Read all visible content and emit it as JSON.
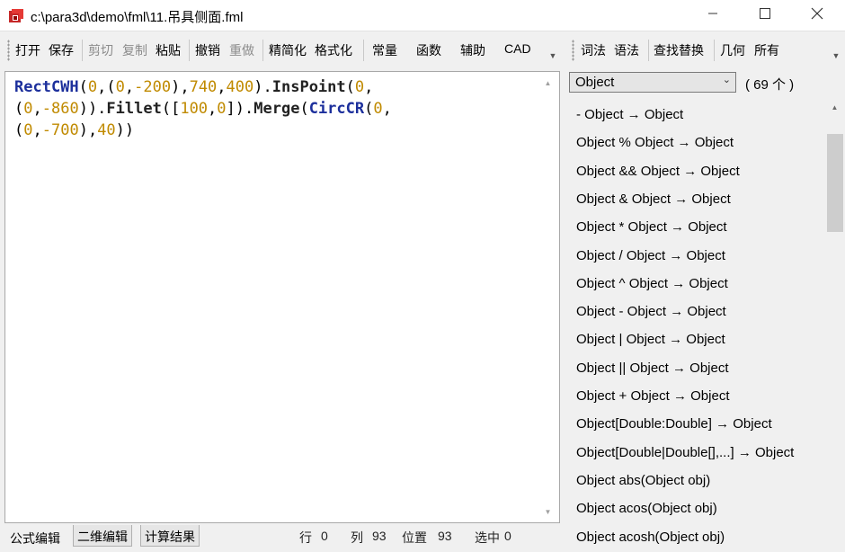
{
  "window": {
    "title": "c:\\para3d\\demo\\fml\\11.吊具侧面.fml",
    "min_glyph": "─",
    "max_glyph": "☐",
    "close_glyph": "✕"
  },
  "toolbar": {
    "open": "打开",
    "save": "保存",
    "cut": "剪切",
    "copy": "复制",
    "paste": "粘贴",
    "undo": "撤销",
    "redo": "重做",
    "simplify": "精简化",
    "format": "格式化",
    "constants": "常量",
    "functions": "函数",
    "helper": "辅助",
    "cad": "CAD"
  },
  "right_toolbar": {
    "lexer": "词法",
    "grammar": "语法",
    "find_replace": "查找替换",
    "geometry": "几何",
    "all": "所有"
  },
  "editor": {
    "line1": [
      {
        "t": "RectCWH",
        "c": "fn"
      },
      {
        "t": "(",
        "c": "pun"
      },
      {
        "t": "0",
        "c": "num"
      },
      {
        "t": ",(",
        "c": "pun"
      },
      {
        "t": "0",
        "c": "num"
      },
      {
        "t": ",",
        "c": "pun"
      },
      {
        "t": "-200",
        "c": "num"
      },
      {
        "t": "),",
        "c": "pun"
      },
      {
        "t": "740",
        "c": "num"
      },
      {
        "t": ",",
        "c": "pun"
      },
      {
        "t": "400",
        "c": "num"
      },
      {
        "t": ").",
        "c": "pun"
      },
      {
        "t": "InsPoint",
        "c": "mt"
      },
      {
        "t": "(",
        "c": "pun"
      },
      {
        "t": "0",
        "c": "num"
      },
      {
        "t": ",",
        "c": "pun"
      }
    ],
    "line2": [
      {
        "t": "(",
        "c": "pun"
      },
      {
        "t": "0",
        "c": "num"
      },
      {
        "t": ",",
        "c": "pun"
      },
      {
        "t": "-860",
        "c": "num"
      },
      {
        "t": ")).",
        "c": "pun"
      },
      {
        "t": "Fillet",
        "c": "mt"
      },
      {
        "t": "([",
        "c": "pun"
      },
      {
        "t": "100",
        "c": "num"
      },
      {
        "t": ",",
        "c": "pun"
      },
      {
        "t": "0",
        "c": "num"
      },
      {
        "t": "]).",
        "c": "pun"
      },
      {
        "t": "Merge",
        "c": "mt"
      },
      {
        "t": "(",
        "c": "pun"
      },
      {
        "t": "CircCR",
        "c": "fn"
      },
      {
        "t": "(",
        "c": "pun"
      },
      {
        "t": "0",
        "c": "num"
      },
      {
        "t": ",",
        "c": "pun"
      }
    ],
    "line3": [
      {
        "t": "(",
        "c": "pun"
      },
      {
        "t": "0",
        "c": "num"
      },
      {
        "t": ",",
        "c": "pun"
      },
      {
        "t": "-700",
        "c": "num"
      },
      {
        "t": "),",
        "c": "pun"
      },
      {
        "t": "40",
        "c": "num"
      },
      {
        "t": "))",
        "c": "pun"
      }
    ]
  },
  "bottom_tabs": {
    "formula": "公式编辑",
    "sketch2d": "二维编辑",
    "result": "计算结果"
  },
  "status": {
    "row_label": "行",
    "row": "0",
    "col_label": "列",
    "col": "93",
    "pos_label": "位置",
    "pos": "93",
    "sel_label": "选中",
    "sel": "0"
  },
  "right_panel": {
    "filter_value": "Object",
    "count_text": "( 69 个 )",
    "items": [
      "- Object → Object",
      "Object % Object → Object",
      "Object && Object → Object",
      "Object & Object → Object",
      "Object * Object → Object",
      "Object / Object → Object",
      "Object ^ Object → Object",
      "Object - Object → Object",
      "Object | Object → Object",
      "Object || Object → Object",
      "Object + Object → Object",
      "Object[Double:Double] → Object",
      "Object[Double|Double[],...] → Object",
      "Object abs(Object obj)",
      "Object acos(Object obj)",
      "Object acosh(Object obj)"
    ]
  }
}
